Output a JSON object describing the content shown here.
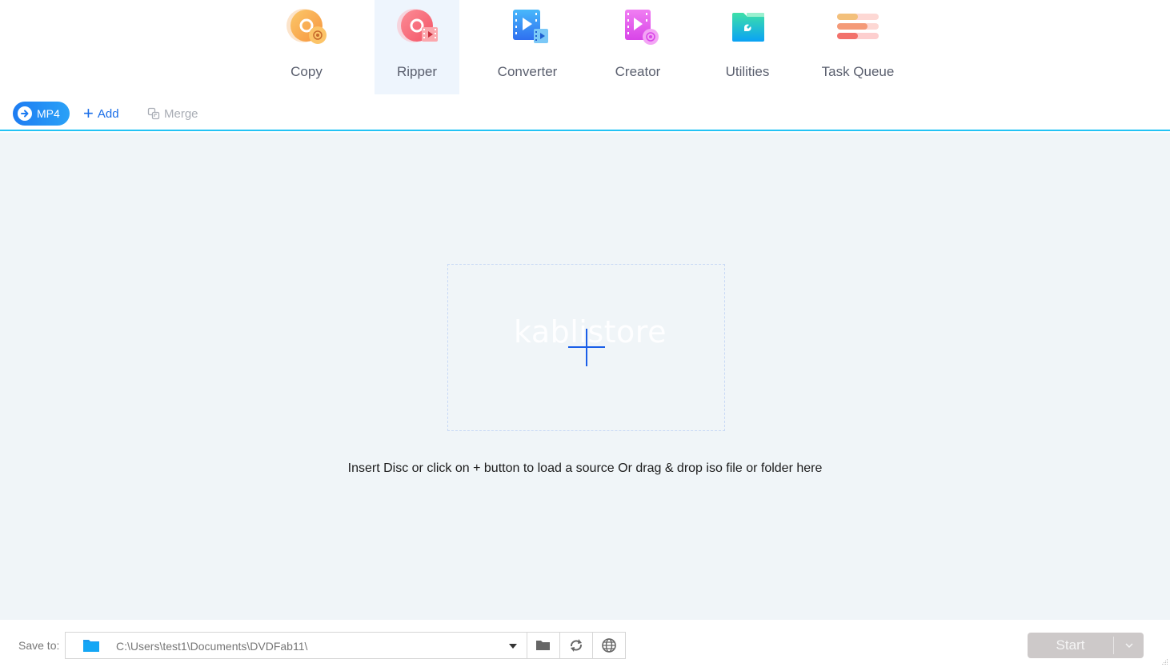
{
  "nav": {
    "items": [
      {
        "id": "copy",
        "label": "Copy",
        "icon": "copy-disc-icon",
        "active": false
      },
      {
        "id": "ripper",
        "label": "Ripper",
        "icon": "ripper-disc-icon",
        "active": true
      },
      {
        "id": "converter",
        "label": "Converter",
        "icon": "converter-video-icon",
        "active": false
      },
      {
        "id": "creator",
        "label": "Creator",
        "icon": "creator-video-icon",
        "active": false
      },
      {
        "id": "utilities",
        "label": "Utilities",
        "icon": "utilities-folder-icon",
        "active": false
      },
      {
        "id": "taskqueue",
        "label": "Task Queue",
        "icon": "task-queue-icon",
        "active": false
      }
    ]
  },
  "toolbar": {
    "profile_label": "MP4",
    "add_label": "Add",
    "merge_label": "Merge"
  },
  "main": {
    "watermark": "kablistore",
    "hint": "Insert Disc or click on + button to load a source Or drag & drop iso file or folder here"
  },
  "footer": {
    "save_to_label": "Save to:",
    "path": "C:\\Users\\test1\\Documents\\DVDFab11\\",
    "start_label": "Start"
  },
  "colors": {
    "accent": "#1a6ee8",
    "separator": "#23c3f5",
    "main_bg": "#f0f5f8",
    "start_disabled": "#cdc9c9"
  }
}
